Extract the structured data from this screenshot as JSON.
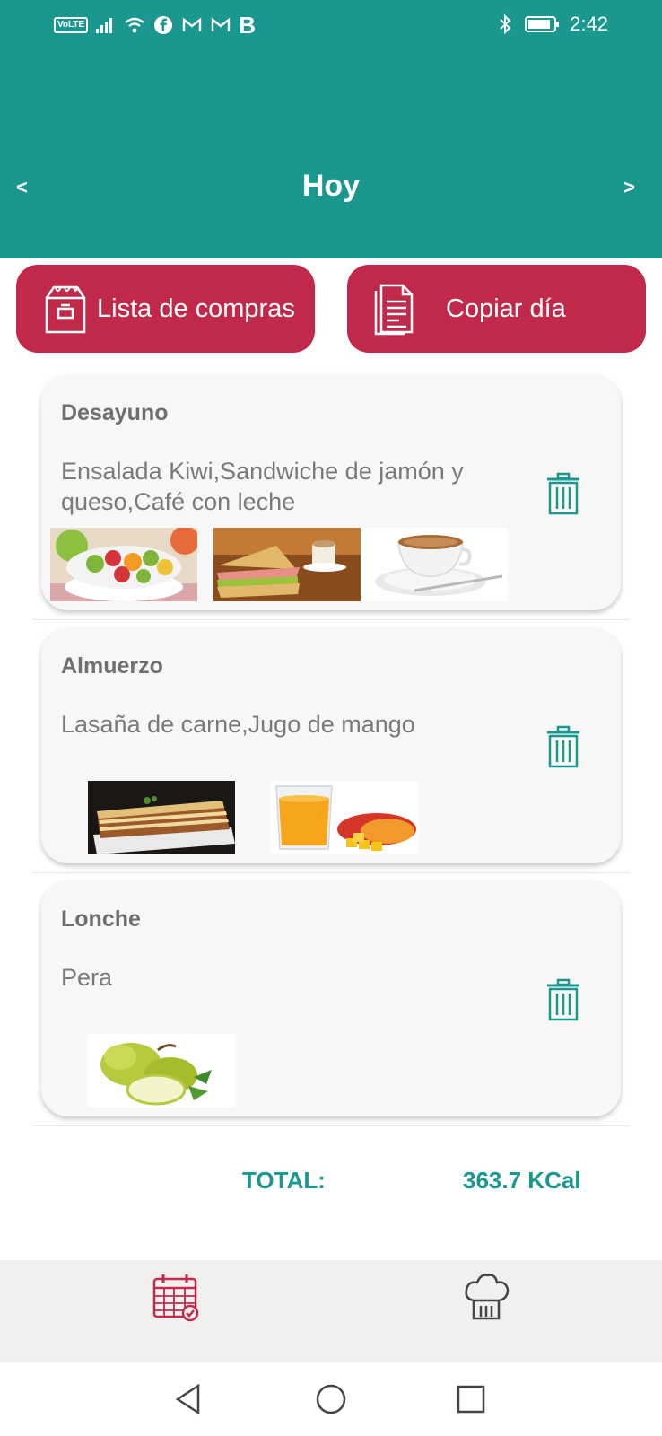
{
  "status_bar": {
    "volte": "VoLTE",
    "carrier_b": "B",
    "time": "2:42"
  },
  "header": {
    "prev": "<",
    "title": "Hoy",
    "next": ">"
  },
  "actions": {
    "shopping_list": "Lista de compras",
    "copy_day": "Copiar día"
  },
  "meals": [
    {
      "title": "Desayuno",
      "description": "Ensalada Kiwi,Sandwiche de jamón y queso,Café con leche"
    },
    {
      "title": "Almuerzo",
      "description": "Lasaña de carne,Jugo de mango"
    },
    {
      "title": "Lonche",
      "description": "Pera"
    }
  ],
  "total": {
    "label": "TOTAL:",
    "value": "363.7 KCal"
  },
  "colors": {
    "primary": "#1a978e",
    "accent": "#c1294b"
  },
  "icons": {
    "shopping": "shopping-bag-icon",
    "copy": "document-icon",
    "delete": "trash-icon",
    "calendar": "calendar-icon",
    "chef": "chef-hat-icon"
  }
}
